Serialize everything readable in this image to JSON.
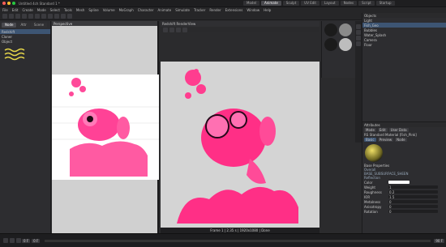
{
  "window": {
    "title": "Untitled 4ch Standard 1 *",
    "layout_label": "Standard"
  },
  "menu": [
    "File",
    "Edit",
    "Create",
    "Mode",
    "Select",
    "Tools",
    "Mesh",
    "Spline",
    "Volume",
    "MoGraph",
    "Character",
    "Animate",
    "Simulate",
    "Tracker",
    "Render",
    "Extensions",
    "Window",
    "Help"
  ],
  "top_tabs": [
    "Model",
    "Animate",
    "Sculpt",
    "UV Edit",
    "Layout",
    "Nodes",
    "Script",
    "Startup"
  ],
  "left_panel": {
    "tabs": [
      "Node",
      "Attr",
      "Scene"
    ],
    "items": [
      "Redshift",
      "Cloner",
      "Object"
    ]
  },
  "viewport_left": {
    "label": "Perspective"
  },
  "viewport_right": {
    "label": "Redshift RenderView",
    "status": "Frame 1 | 2.35 s | 1920x1080 | Done"
  },
  "materials": [
    "RS Standard",
    "RS Standard",
    "RS Standard",
    "RS Standard",
    "RS Standard",
    "RS Standard"
  ],
  "object_manager": {
    "title": "Objects",
    "items": [
      "Light",
      "Fish_Geo",
      "Bubbles",
      "Water_Splash",
      "Camera",
      "Floor"
    ]
  },
  "attributes": {
    "title": "Attributes",
    "mode_tabs": [
      "Mode",
      "Edit",
      "User Data"
    ],
    "header": "RS Standard Material [Fish_Pink]",
    "tabs": [
      "Basic",
      "Preview",
      "Node"
    ],
    "sub_label": "Base Properties",
    "section1": "Overall",
    "section2": "BASE_SUBSURFACE_SHEEN",
    "section3": "Reflection",
    "rows": [
      {
        "label": "Color",
        "value": ""
      },
      {
        "label": "Weight",
        "value": "1"
      },
      {
        "label": "Roughness",
        "value": "0.2"
      },
      {
        "label": "IOR",
        "value": "1.5"
      },
      {
        "label": "Metalness",
        "value": "0"
      },
      {
        "label": "Anisotropy",
        "value": "0"
      },
      {
        "label": "Rotation",
        "value": "0"
      }
    ]
  },
  "timeline": {
    "start": "0 F",
    "end": "90 F",
    "current": "0 F"
  },
  "colors": {
    "accent": "#3d5573",
    "pink": "#ff2f86",
    "viewport": "#d4d4d4"
  }
}
